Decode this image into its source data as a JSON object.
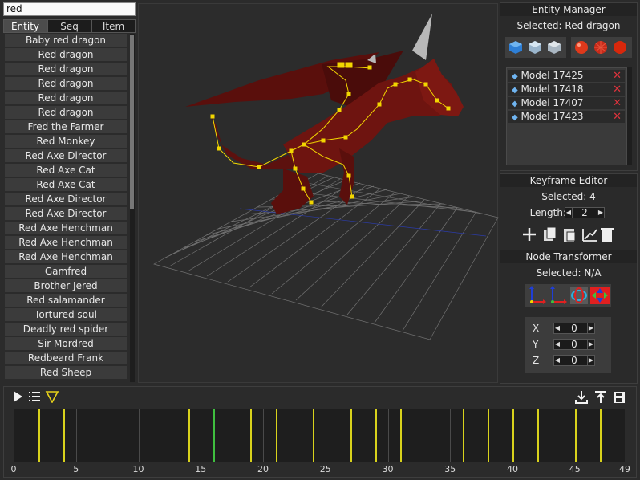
{
  "search": {
    "value": "red"
  },
  "tabs": [
    "Entity",
    "Seq",
    "Item"
  ],
  "entity_list": [
    "Baby red dragon",
    "Red dragon",
    "Red dragon",
    "Red dragon",
    "Red dragon",
    "Red dragon",
    "Fred the Farmer",
    "Red Monkey",
    "Red Axe Director",
    "Red Axe Cat",
    "Red Axe Cat",
    "Red Axe Director",
    "Red Axe Director",
    "Red Axe Henchman",
    "Red Axe Henchman",
    "Red Axe Henchman",
    "Gamfred",
    "Brother Jered",
    "Red salamander",
    "Tortured soul",
    "Deadly red spider",
    "Sir Mordred",
    "Redbeard Frank",
    "Red Sheep"
  ],
  "entity_manager": {
    "title": "Entity Manager",
    "selected": "Selected: Red dragon",
    "models": [
      "Model 17425",
      "Model 17418",
      "Model 17407",
      "Model 17423"
    ],
    "remove_glyph": "✕"
  },
  "keyframe_editor": {
    "title": "Keyframe Editor",
    "selected": "Selected: 4",
    "length_label": "Length:",
    "length_value": "2"
  },
  "node_transformer": {
    "title": "Node Transformer",
    "selected": "Selected: N/A",
    "x_label": "X",
    "x_value": "0",
    "y_label": "Y",
    "y_value": "0",
    "z_label": "Z",
    "z_value": "0"
  },
  "timeline": {
    "ticks": [
      "0",
      "5",
      "10",
      "15",
      "20",
      "25",
      "30",
      "35",
      "40",
      "45",
      "49"
    ],
    "max_frame": 49,
    "yellow_keyframes": [
      2,
      4,
      14,
      19,
      21,
      24,
      27,
      29,
      31,
      36,
      38,
      40,
      42,
      45,
      47
    ],
    "green_keyframes": [
      16
    ],
    "colors": {
      "keyframe": "#d8d21c",
      "current": "#3fbf3f",
      "grid": "#4a4a4a"
    }
  },
  "icons": {
    "play": "play-icon",
    "list": "list-icon",
    "filter": "filter-icon",
    "import": "import-icon",
    "export": "export-icon",
    "save": "save-icon"
  },
  "colors": {
    "accent": "#e0333d",
    "dragon": "#6e1410",
    "bone": "#f2d600"
  }
}
